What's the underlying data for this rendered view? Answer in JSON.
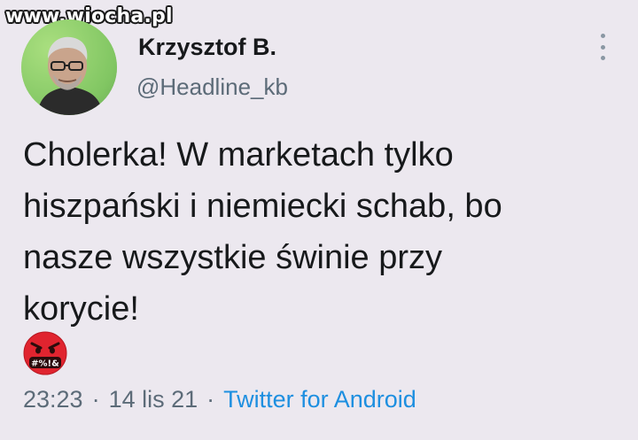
{
  "watermark": "www.wiocha.pl",
  "author": {
    "display_name": "Krzysztof B.",
    "handle": "@Headline_kb"
  },
  "tweet": {
    "lines": [
      "Cholerka! W marketach tylko",
      "hiszpański i niemiecki schab, bo",
      "nasze wszystkie świnie przy",
      "korycie!"
    ],
    "emoji": {
      "name": "face-with-symbols-on-mouth",
      "label": "#%!&"
    }
  },
  "meta": {
    "time": "23:23",
    "separator": "·",
    "date": "14 lis 21",
    "source": "Twitter for Android"
  },
  "colors": {
    "background": "#ece8ef",
    "text": "#17191b",
    "secondary": "#5c6b78",
    "link": "#1d8fe0",
    "emoji_red": "#e0242f"
  }
}
